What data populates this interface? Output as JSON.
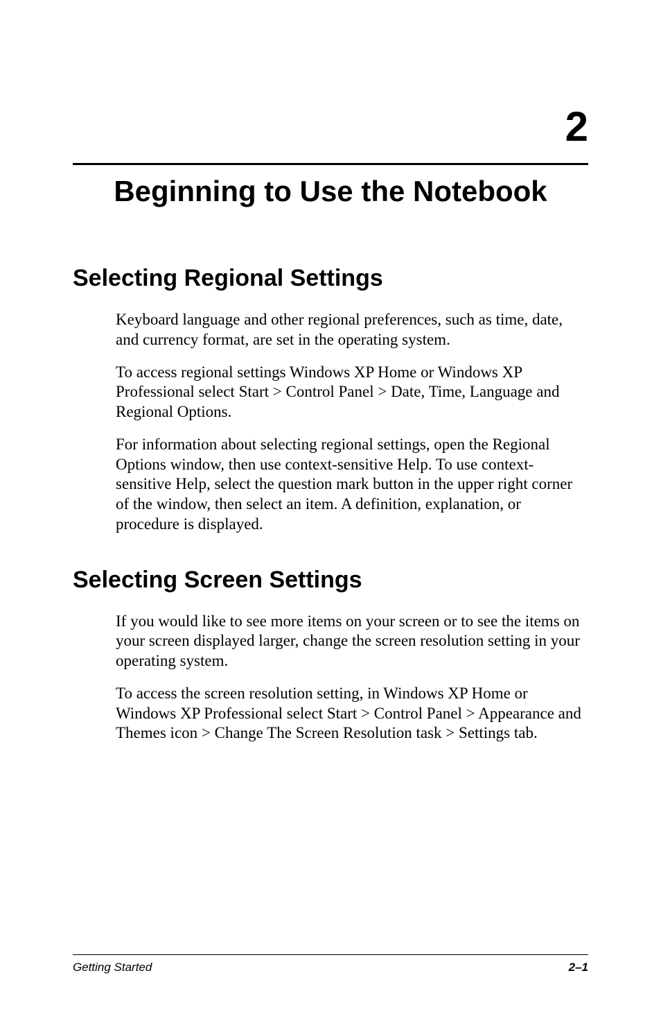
{
  "chapter": {
    "number": "2",
    "title": "Beginning to Use the Notebook"
  },
  "sections": [
    {
      "heading": "Selecting Regional Settings",
      "paragraphs": [
        "Keyboard language and other regional preferences, such as time, date, and currency format, are set in the operating system.",
        "To access regional settings Windows XP Home or Windows XP Professional select Start > Control Panel > Date, Time, Language and Regional Options.",
        "For information about selecting regional settings, open the Regional Options window, then use context-sensitive Help. To use context-sensitive Help, select the question mark button in the upper right corner of the window, then select an item. A definition, explanation, or procedure is displayed."
      ]
    },
    {
      "heading": "Selecting Screen Settings",
      "paragraphs": [
        "If you would like to see more items on your screen or to see the items on your screen displayed larger, change the screen resolution setting in your operating system.",
        "To access the screen resolution setting, in Windows XP Home or Windows XP Professional select Start > Control Panel > Appearance and Themes icon > Change The Screen Resolution task > Settings tab."
      ]
    }
  ],
  "footer": {
    "left": "Getting Started",
    "right": "2–1"
  }
}
